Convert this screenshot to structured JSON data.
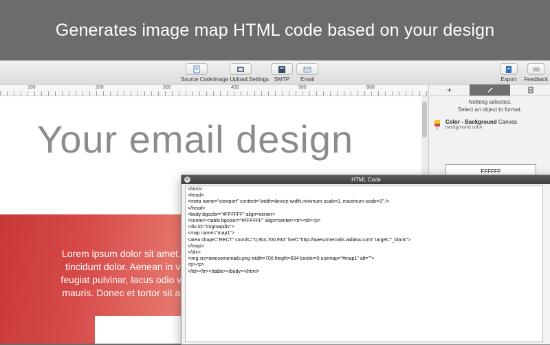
{
  "banner": {
    "headline": "Generates image map HTML code based on your design"
  },
  "toolbar": {
    "source_code": "Source Code",
    "image_upload": "Image Upload Settings",
    "smtp": "SMTP",
    "email": "Email",
    "export": "Export",
    "feedback": "Feedback"
  },
  "ruler": {
    "marks": [
      "100",
      "200",
      "300",
      "400",
      "500",
      "600"
    ]
  },
  "canvas": {
    "title": "Your email design",
    "lorem": [
      "Lorem ipsum dolor sit amet, cor",
      "tincidunt dolor. Aenean in vulp",
      "feugiat pulvinar, lacus odio variu",
      "mauris. Donec et tortor sit amet"
    ]
  },
  "panel": {
    "tab_add": "+",
    "nothing_selected": "Nothing selected.",
    "select_hint": "Select an object to format.",
    "color_title": "Color - Background",
    "color_target": "Canvas",
    "color_sub": "background color",
    "hex_value": "FFFFFF"
  },
  "code_window": {
    "title": "HTML Code",
    "lines": [
      "<html>",
      "<head>",
      "<meta name=\"viewport\" content=\"width=device-width,minimum-scale=1, maximum-scale=1\" />",
      "</head>",
      "<body bgcolor=\"#FFFFFF\" align=center>",
      "<center><table bgcolor=\"#FFFFFF\" align=center><tr><td><p>",
      "<div id=\"imgmapdiv\">",
      "<map name=\"map1\">",
      "<area shape=\"RECT\" coords=\"0,904,700,934\" href=\"http://awesomemails.aidaluu.com\" target=\"_blank\">",
      "</map>",
      "</div>",
      "<img src=awesomemails.png width=700 height=934 border=0 usemap=\"#map1\" alt=\"\">",
      "<p><p>",
      "</td></tr></table></body></html>"
    ]
  },
  "colors": {
    "banner": "#6c6c6c",
    "accent_photo": "#d64a48",
    "export_blue": "#2f6fb8"
  }
}
